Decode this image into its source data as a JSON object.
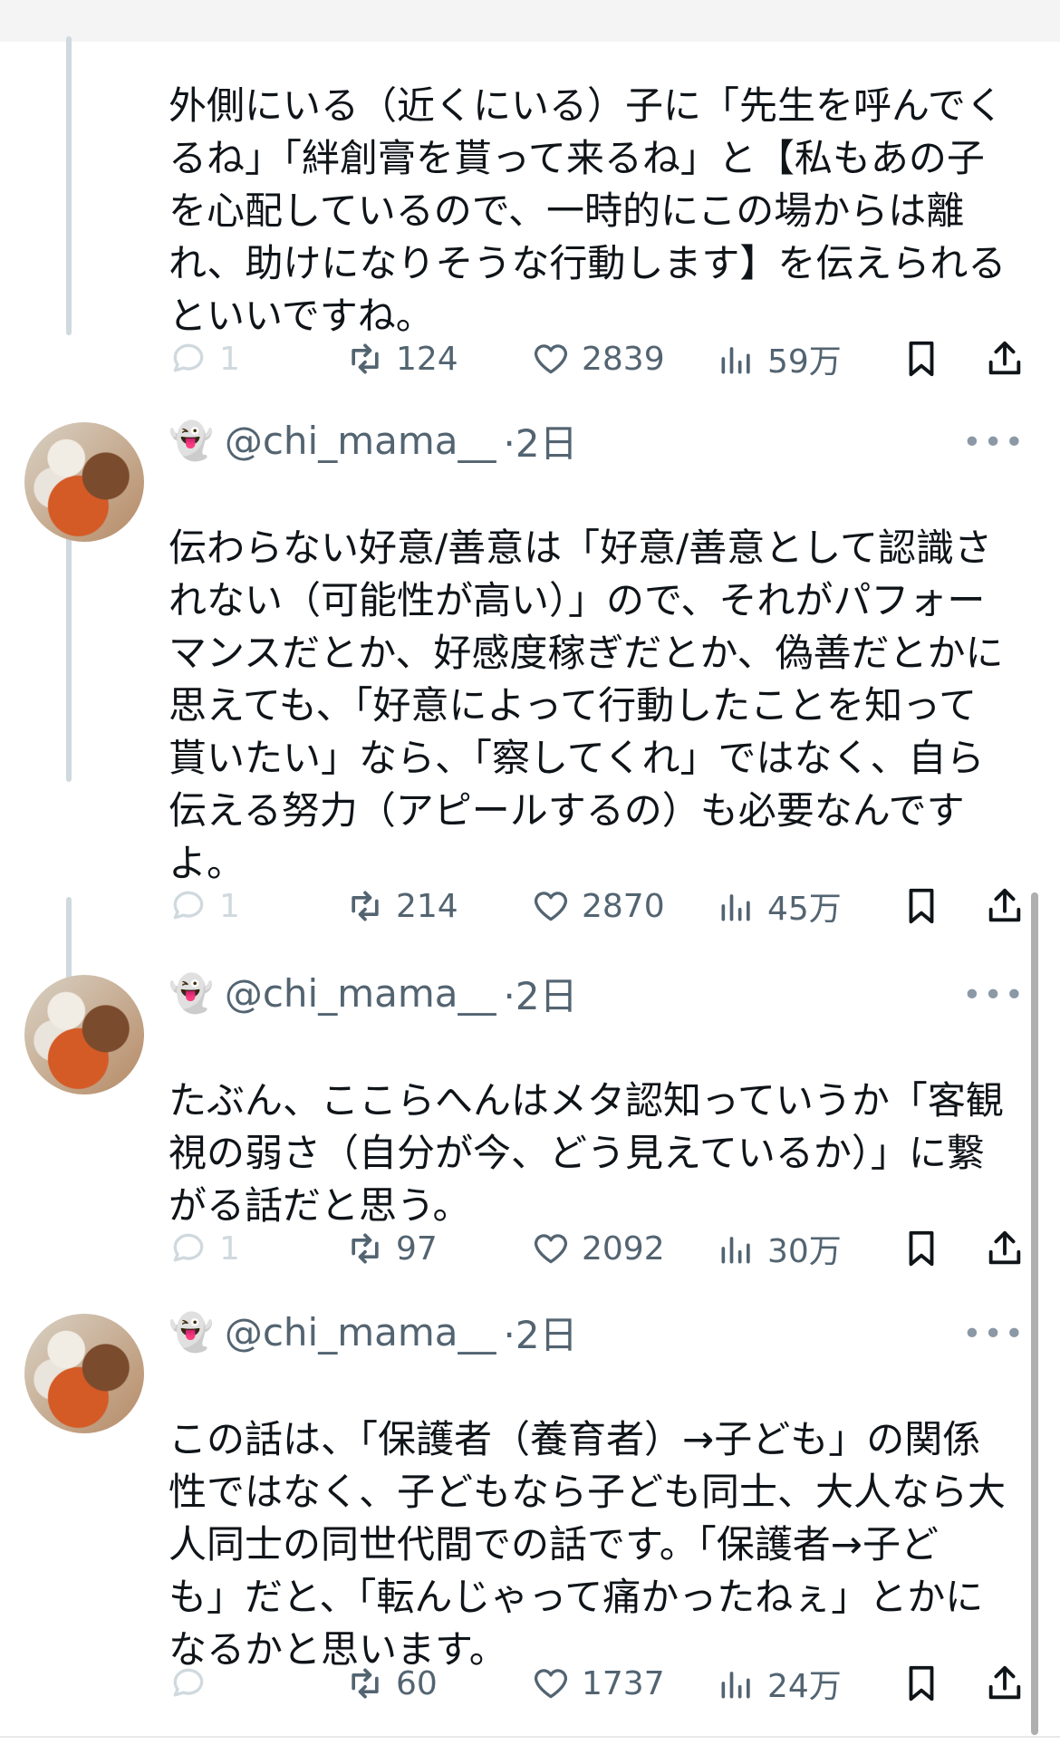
{
  "posts": [
    {
      "text": "外側にいる（近くにいる）子に「先生を呼んでくるね」「絆創膏を貰って来るね」と【私もあの子を心配しているので、一時的にこの場からは離れ、助けになりそうな行動します】を伝えられるといいですね。",
      "replies": "1",
      "reposts": "124",
      "likes": "2839",
      "views": "59万"
    },
    {
      "handle": "@chi_mama__",
      "time": "·2日",
      "text": "伝わらない好意/善意は「好意/善意として認識されない（可能性が高い）」ので、それがパフォーマンスだとか、好感度稼ぎだとか、偽善だとかに思えても、「好意によって行動したことを知って貰いたい」なら、「察してくれ」ではなく、自ら伝える努力（アピールするの）も必要なんですよ。",
      "replies": "1",
      "reposts": "214",
      "likes": "2870",
      "views": "45万"
    },
    {
      "handle": "@chi_mama__",
      "time": "·2日",
      "text": "たぶん、ここらへんはメタ認知っていうか「客観視の弱さ（自分が今、どう見えているか）」に繋がる話だと思う。",
      "replies": "1",
      "reposts": "97",
      "likes": "2092",
      "views": "30万"
    },
    {
      "handle": "@chi_mama__",
      "time": "·2日",
      "text": "この話は、「保護者（養育者）→子ども」の関係性ではなく、子どもなら子ども同士、大人なら大人同士の同世代間での話です。「保護者→子ども」だと、「転んじゃって痛かったねぇ」とかになるかと思います。",
      "replies": "",
      "reposts": "60",
      "likes": "1737",
      "views": "24万"
    }
  ],
  "lines": {
    "p0": [
      "外側にいる（近くにいる）子に「先生を呼んでく",
      "るね」「絆創膏を貰って来るね」と【私もあの子",
      "を心配しているので、一時的にこの場からは離",
      "れ、助けになりそうな行動します】を伝えられる",
      "といいですね。"
    ],
    "p1": [
      "伝わらない好意/善意は「好意/善意として認識さ",
      "れない（可能性が高い）」ので、それがパフォー",
      "マンスだとか、好感度稼ぎだとか、偽善だとかに",
      "思えても、「好意によって行動したことを知って",
      "貰いたい」なら、「察してくれ」ではなく、自ら",
      "伝える努力（アピールするの）も必要なんです",
      "よ。"
    ],
    "p2": [
      "たぶん、ここらへんはメタ認知っていうか「客観",
      "視の弱さ（自分が今、どう見えているか）」に繋",
      "がる話だと思う。"
    ],
    "p3": [
      "この話は、「保護者（養育者）→子ども」の関係",
      "性ではなく、子どもなら子ども同士、大人なら大",
      "人同士の同世代間での話です。「保護者→子ど",
      "も」だと、「転んじゃって痛かったねぇ」とかに",
      "なるかと思います。"
    ]
  },
  "icons": {
    "reply": "reply-bubble-icon",
    "repost": "repost-icon",
    "like": "heart-icon",
    "views": "views-bar-icon",
    "bookmark": "bookmark-icon",
    "share": "share-icon",
    "handle_emoji": "👻",
    "more": "•••"
  }
}
